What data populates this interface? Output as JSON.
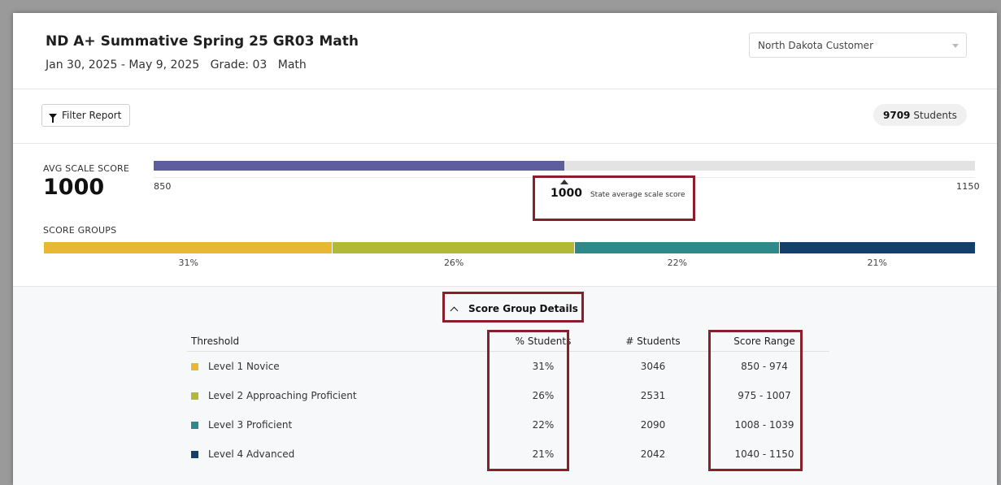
{
  "header": {
    "title": "ND A+ Summative Spring 25 GR03 Math",
    "date_range": "Jan 30, 2025 - May 9, 2025",
    "grade": "Grade: 03",
    "subject": "Math",
    "customer_select": "North Dakota Customer"
  },
  "toolbar": {
    "filter_label": "Filter Report",
    "students_count": "9709",
    "students_label": "Students"
  },
  "summary": {
    "avg_label": "AVG SCALE SCORE",
    "avg_value": "1000",
    "scale_min": "850",
    "scale_max": "1150",
    "scale_min_num": 850,
    "scale_max_num": 1150,
    "avg_num": 1000,
    "state_avg_value": "1000",
    "state_avg_label": "State average scale score",
    "scale_color": "#5e5d9e",
    "groups_label": "SCORE GROUPS",
    "groups": [
      {
        "pct": "31%",
        "value": 31,
        "color": "#e8b835"
      },
      {
        "pct": "26%",
        "value": 26,
        "color": "#b1b936"
      },
      {
        "pct": "22%",
        "value": 22,
        "color": "#2e8a8a"
      },
      {
        "pct": "21%",
        "value": 21,
        "color": "#123f6b"
      }
    ]
  },
  "details": {
    "toggle_label": "Score Group Details",
    "headers": {
      "threshold": "Threshold",
      "pct_students": "% Students",
      "num_students": "# Students",
      "score_range": "Score Range"
    },
    "rows": [
      {
        "level": "Level 1 Novice",
        "pct": "31%",
        "count": "3046",
        "range": "850 - 974",
        "color": "#e8b835"
      },
      {
        "level": "Level 2 Approaching Proficient",
        "pct": "26%",
        "count": "2531",
        "range": "975 - 1007",
        "color": "#b1b936"
      },
      {
        "level": "Level 3 Proficient",
        "pct": "22%",
        "count": "2090",
        "range": "1008 - 1039",
        "color": "#2e8a8a"
      },
      {
        "level": "Level 4 Advanced",
        "pct": "21%",
        "count": "2042",
        "range": "1040 - 1150",
        "color": "#123f6b"
      }
    ]
  },
  "annotation_color": "#8a1f2b"
}
